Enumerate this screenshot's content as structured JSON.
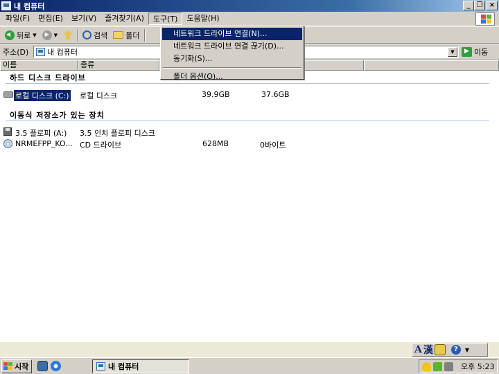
{
  "window": {
    "title": "내 컴퓨터"
  },
  "menubar": {
    "items": [
      "파일(F)",
      "편집(E)",
      "보기(V)",
      "즐겨찾기(A)",
      "도구(T)",
      "도움말(H)"
    ]
  },
  "toolbar": {
    "back_label": "뒤로",
    "search_label": "검색",
    "folders_label": "폴더"
  },
  "address": {
    "label": "주소(D)",
    "value": "내 컴퓨터",
    "go_label": "이동"
  },
  "columns": [
    "이름",
    "종류",
    "",
    "",
    "",
    "",
    ""
  ],
  "groups": {
    "hard_disks": "하드 디스크 드라이브",
    "removable": "이동식 저장소가 있는 장치"
  },
  "drives": [
    {
      "name": "로컬 디스크 (C:)",
      "type": "로컬 디스크",
      "total": "39.9GB",
      "free": "37.6GB"
    },
    {
      "name": "3.5 플로피 (A:)",
      "type": "3.5 인치 플로피 디스크",
      "total": "",
      "free": ""
    },
    {
      "name": "NRMEFPP_KO...",
      "type": "CD 드라이브",
      "total": "628MB",
      "free": "0바이트"
    }
  ],
  "tools_menu": {
    "items": [
      "네트워크 드라이브 연결(N)...",
      "네트워크 드라이브 연결 끊기(D)...",
      "동기화(S)...",
      "폴더 옵션(O)..."
    ]
  },
  "langbar": {
    "mode": "A",
    "hanja": "漢"
  },
  "taskbar": {
    "start_label": "시작",
    "task_label": "내 컴퓨터",
    "clock": "오후 5:23"
  },
  "colors": {
    "titlebar": "#0a246a",
    "highlight": "#0a246a",
    "chrome": "#d4d0c8"
  }
}
